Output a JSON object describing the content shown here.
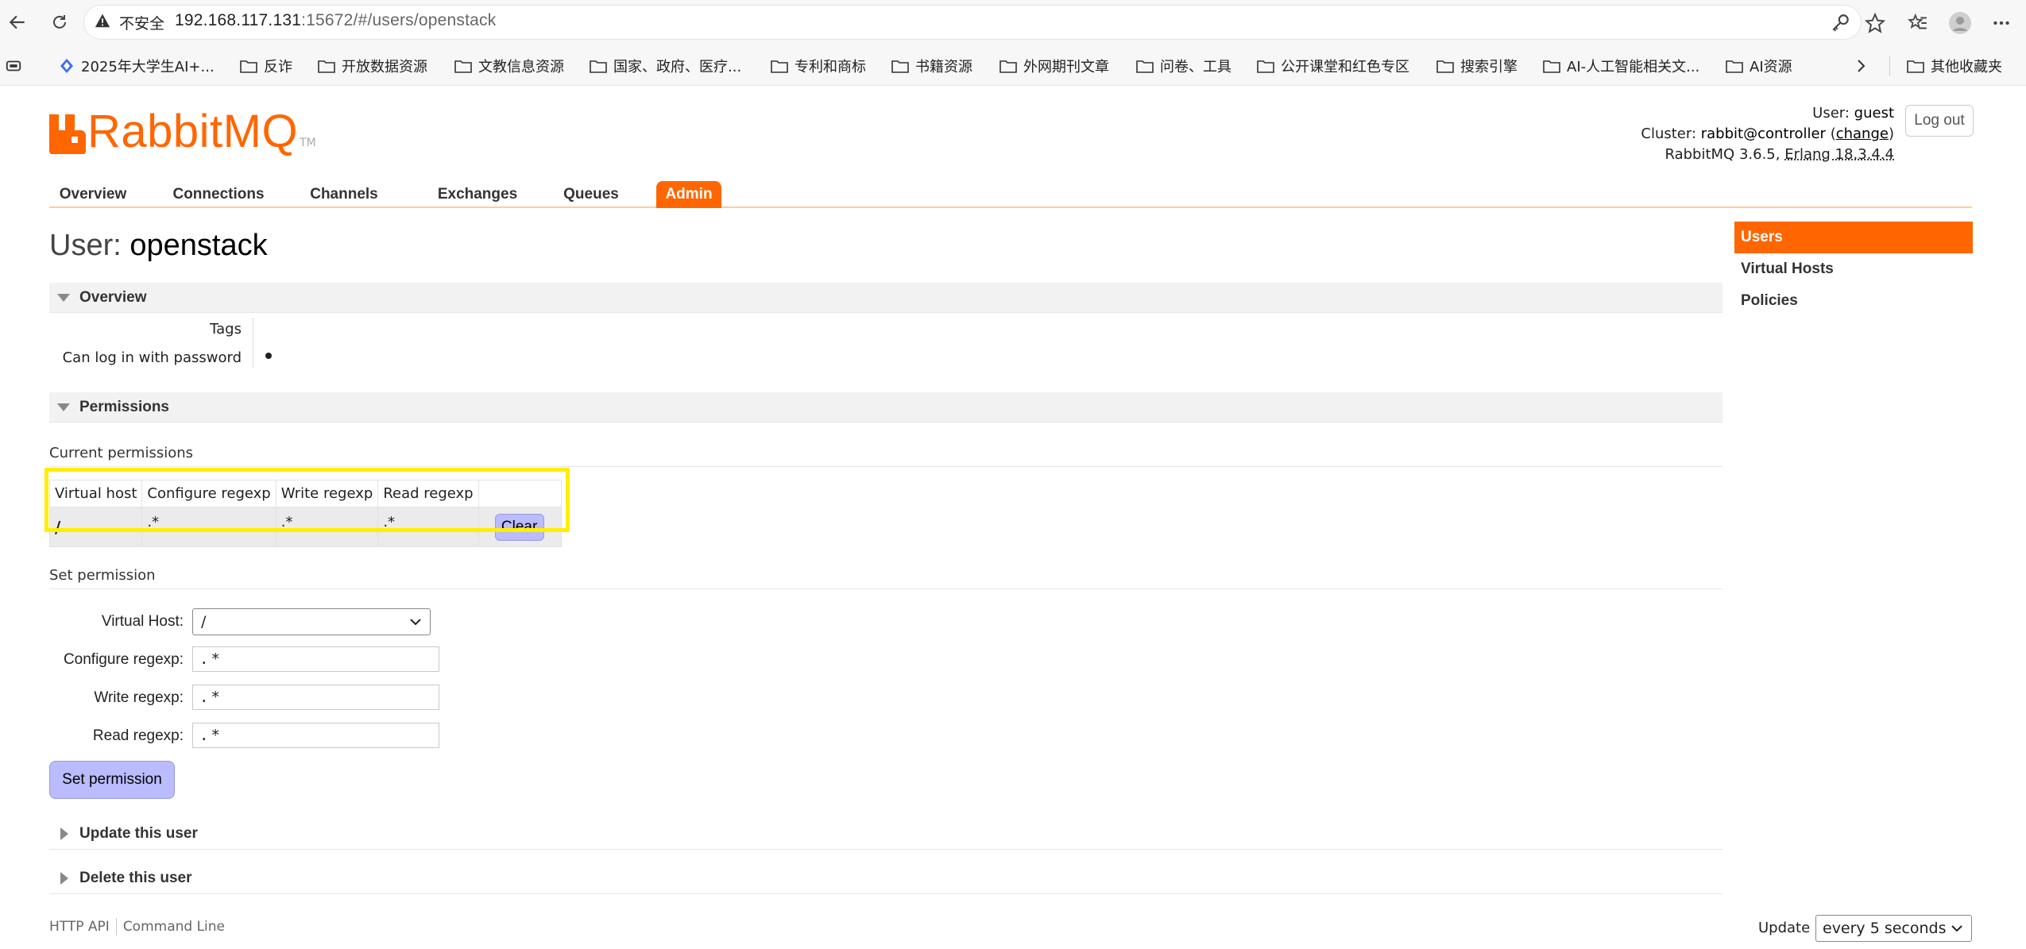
{
  "browser": {
    "security_label": "不安全",
    "url_host": "192.168.117.131",
    "url_rest": ":15672/#/users/openstack",
    "bookmarks": [
      {
        "label": "2025年大学生AI+...",
        "icon": "ai-app-icon"
      },
      {
        "label": "反诈",
        "icon": "folder-icon"
      },
      {
        "label": "开放数据资源",
        "icon": "folder-icon"
      },
      {
        "label": "文教信息资源",
        "icon": "folder-icon"
      },
      {
        "label": "国家、政府、医疗...",
        "icon": "folder-icon"
      },
      {
        "label": "专利和商标",
        "icon": "folder-icon"
      },
      {
        "label": "书籍资源",
        "icon": "folder-icon"
      },
      {
        "label": "外网期刊文章",
        "icon": "folder-icon"
      },
      {
        "label": "问卷、工具",
        "icon": "folder-icon"
      },
      {
        "label": "公开课堂和红色专区",
        "icon": "folder-icon"
      },
      {
        "label": "搜索引擎",
        "icon": "folder-icon"
      },
      {
        "label": "AI-人工智能相关文...",
        "icon": "folder-icon"
      },
      {
        "label": "AI资源",
        "icon": "folder-icon"
      }
    ],
    "other_bookmarks": "其他收藏夹"
  },
  "header": {
    "logo_text": "RabbitMQ",
    "logo_tm": "TM",
    "user_label": "User:",
    "user_value": "guest",
    "cluster_label": "Cluster:",
    "cluster_value": "rabbit@controller",
    "change_link": "change",
    "version_text": "RabbitMQ 3.6.5,",
    "erlang_text": "Erlang 18.3.4.4",
    "logout": "Log out"
  },
  "nav": {
    "tabs": [
      "Overview",
      "Connections",
      "Channels",
      "Exchanges",
      "Queues",
      "Admin"
    ],
    "active": "Admin"
  },
  "title": {
    "prefix": "User:",
    "name": "openstack"
  },
  "overview": {
    "heading": "Overview",
    "tags_label": "Tags",
    "tags_value": "",
    "login_label": "Can log in with password"
  },
  "permissions": {
    "heading": "Permissions",
    "current_heading": "Current permissions",
    "columns": [
      "Virtual host",
      "Configure regexp",
      "Write regexp",
      "Read regexp"
    ],
    "rows": [
      {
        "vhost": "/",
        "configure": ".*",
        "write": ".*",
        "read": ".*",
        "action": "Clear"
      }
    ],
    "set_heading": "Set permission",
    "vhost_label": "Virtual Host:",
    "vhost_value": "/",
    "configure_label": "Configure regexp:",
    "configure_value": ".*",
    "write_label": "Write regexp:",
    "write_value": ".*",
    "read_label": "Read regexp:",
    "read_value": ".*",
    "submit": "Set permission"
  },
  "update_user": "Update this user",
  "delete_user": "Delete this user",
  "footer": {
    "http_api": "HTTP API",
    "command_line": "Command Line",
    "update_label": "Update",
    "update_value": "every 5 seconds"
  },
  "side_nav": {
    "items": [
      "Users",
      "Virtual Hosts",
      "Policies"
    ],
    "active": "Users"
  },
  "colors": {
    "brand_orange": "#ff6600",
    "button_lavender": "#bbbbff",
    "highlight_yellow": "#ffee00"
  }
}
